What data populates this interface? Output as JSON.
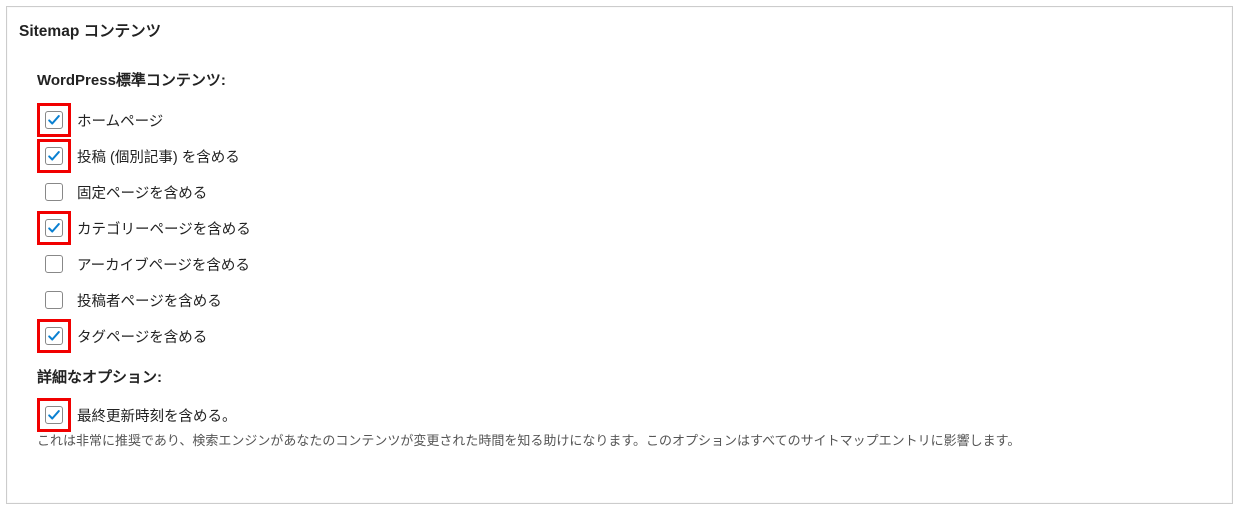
{
  "panel": {
    "title": "Sitemap コンテンツ"
  },
  "section_standard": {
    "heading": "WordPress標準コンテンツ:",
    "items": [
      {
        "label": "ホームページ",
        "checked": true,
        "highlight": true
      },
      {
        "label": "投稿 (個別記事) を含める",
        "checked": true,
        "highlight": true
      },
      {
        "label": "固定ページを含める",
        "checked": false,
        "highlight": false
      },
      {
        "label": "カテゴリーページを含める",
        "checked": true,
        "highlight": true
      },
      {
        "label": "アーカイブページを含める",
        "checked": false,
        "highlight": false
      },
      {
        "label": "投稿者ページを含める",
        "checked": false,
        "highlight": false
      },
      {
        "label": "タグページを含める",
        "checked": true,
        "highlight": true
      }
    ]
  },
  "section_advanced": {
    "heading": "詳細なオプション:",
    "item": {
      "label": "最終更新時刻を含める。",
      "checked": true,
      "highlight": true
    },
    "description": "これは非常に推奨であり、検索エンジンがあなたのコンテンツが変更された時間を知る助けになります。このオプションはすべてのサイトマップエントリに影響します。"
  },
  "colors": {
    "check_stroke": "#0a80d1",
    "highlight_border": "#f10000"
  }
}
